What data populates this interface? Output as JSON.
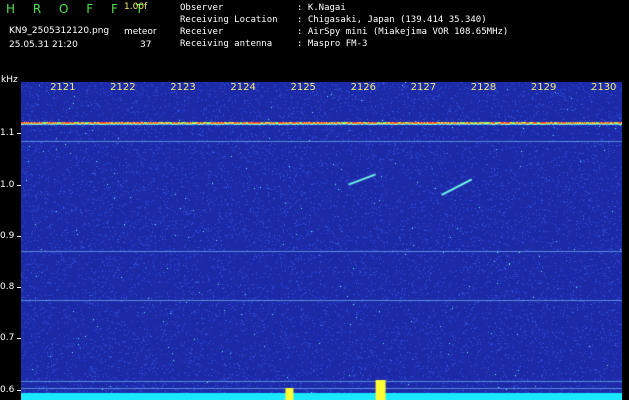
{
  "header": {
    "app_name": "H R O F F T",
    "version": "1.00f",
    "file_name": "KN9_2505312120.png",
    "datetime": "25.05.31 21:20",
    "meteor_label": "meteor",
    "meteor_count": "37"
  },
  "info": [
    {
      "label": "Observer",
      "value": ": K.Nagai"
    },
    {
      "label": "Receiving Location",
      "value": ": Chigasaki, Japan (139.414 35.340)"
    },
    {
      "label": "Receiver",
      "value": ": AirSpy mini (Miakejima VOR 108.65MHz)"
    },
    {
      "label": "Receiving antenna",
      "value": ": Maspro FM-3"
    }
  ],
  "chart_data": {
    "type": "heatmap",
    "ylabel": "kHz",
    "ylim": [
      0.58,
      1.2
    ],
    "yticks": [
      "1.1",
      "1.0",
      "0.9",
      "0.8",
      "0.7",
      "0.6"
    ],
    "xlim": [
      2120.3,
      2130.3
    ],
    "xticks": [
      "2121",
      "2122",
      "2123",
      "2124",
      "2125",
      "2126",
      "2127",
      "2128",
      "2129",
      "2130"
    ],
    "carrier_khz": 1.12,
    "meteor_echoes": [
      {
        "x0": 2125.75,
        "x1": 2126.2,
        "y0": 1.0,
        "y1": 1.02
      },
      {
        "x0": 2127.3,
        "x1": 2127.8,
        "y0": 0.98,
        "y1": 1.01
      }
    ],
    "colors": {
      "background": "#1c2aa8",
      "noise_low": "#2a46d8",
      "noise_high": "#6ef6e6",
      "carrier": "#ff3a3a",
      "accent": "#f6ee6a"
    }
  }
}
